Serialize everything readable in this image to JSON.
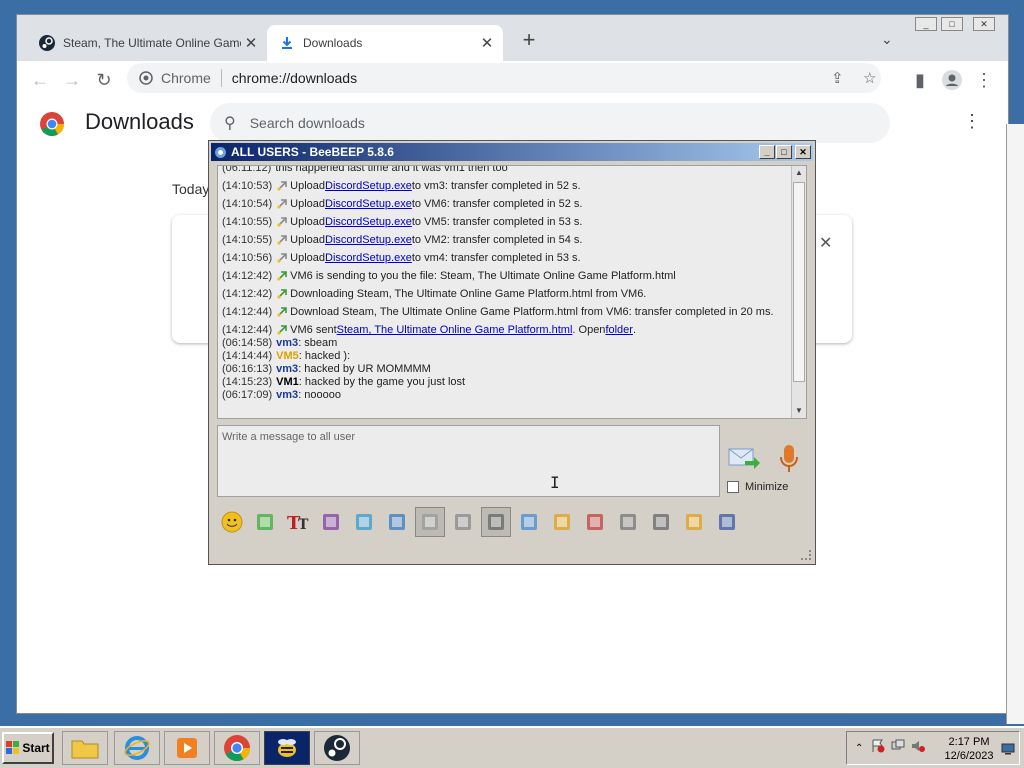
{
  "browser": {
    "tabs": [
      {
        "title": "Steam, The Ultimate Online Game P"
      },
      {
        "title": "Downloads"
      }
    ],
    "site_label": "Chrome",
    "url": "chrome://downloads"
  },
  "downloads_page": {
    "title": "Downloads",
    "search_placeholder": "Search downloads",
    "section_label": "Today"
  },
  "beebeep": {
    "title": "ALL USERS - BeeBEEP 5.8.6",
    "chat": [
      {
        "ts": "(06:11:12)",
        "pre": "this happened last time and it was vm1 then too",
        "icon": "",
        "who": "",
        "link": "",
        "post": "",
        "link2": "",
        "post2": ""
      },
      {
        "ts": "(14:10:53)",
        "icon": "upload-icon",
        "pre": "Upload ",
        "link": "DiscordSetup.exe",
        "post": " to vm3: transfer completed in 52 s.",
        "who": "",
        "link2": "",
        "post2": ""
      },
      {
        "ts": "(14:10:54)",
        "icon": "upload-icon",
        "pre": "Upload ",
        "link": "DiscordSetup.exe",
        "post": " to VM6: transfer completed in 52 s.",
        "who": "",
        "link2": "",
        "post2": ""
      },
      {
        "ts": "(14:10:55)",
        "icon": "upload-icon",
        "pre": "Upload ",
        "link": "DiscordSetup.exe",
        "post": " to VM5: transfer completed in 53 s.",
        "who": "",
        "link2": "",
        "post2": ""
      },
      {
        "ts": "(14:10:55)",
        "icon": "upload-icon",
        "pre": "Upload ",
        "link": "DiscordSetup.exe",
        "post": " to VM2: transfer completed in 54 s.",
        "who": "",
        "link2": "",
        "post2": ""
      },
      {
        "ts": "(14:10:56)",
        "icon": "upload-icon",
        "pre": "Upload ",
        "link": "DiscordSetup.exe",
        "post": " to vm4: transfer completed in 53 s.",
        "who": "",
        "link2": "",
        "post2": ""
      },
      {
        "ts": "(14:12:42)",
        "icon": "download-icon",
        "pre": "VM6 is sending to you the file: Steam, The Ultimate Online Game Platform.html",
        "link": "",
        "post": "",
        "who": "",
        "link2": "",
        "post2": ""
      },
      {
        "ts": "(14:12:42)",
        "icon": "download-icon",
        "pre": "Downloading Steam, The Ultimate Online Game Platform.html from VM6.",
        "link": "",
        "post": "",
        "who": "",
        "link2": "",
        "post2": ""
      },
      {
        "ts": "(14:12:44)",
        "icon": "download-icon",
        "pre": "Download Steam, The Ultimate Online Game Platform.html from VM6: transfer completed in 20 ms.",
        "link": "",
        "post": "",
        "who": "",
        "link2": "",
        "post2": ""
      },
      {
        "ts": "(14:12:44)",
        "icon": "download-icon",
        "pre": "VM6 sent ",
        "link": "Steam, The Ultimate Online Game Platform.html",
        "post": ". Open ",
        "link2": "folder",
        "post2": ".",
        "who": ""
      },
      {
        "ts": "(06:14:58)",
        "icon": "",
        "who": "vm3",
        "whoColor": "#1a3a9a",
        "pre": ": sbeam",
        "link": "",
        "post": "",
        "link2": "",
        "post2": ""
      },
      {
        "ts": "(14:14:44)",
        "icon": "",
        "who": "VM5",
        "whoColor": "#e0a000",
        "pre": ": hacked ):",
        "link": "",
        "post": "",
        "link2": "",
        "post2": ""
      },
      {
        "ts": "(06:16:13)",
        "icon": "",
        "who": "vm3",
        "whoColor": "#1a3a9a",
        "pre": ": hacked by UR MOMMMM",
        "link": "",
        "post": "",
        "link2": "",
        "post2": ""
      },
      {
        "ts": "(14:15:23)",
        "icon": "",
        "who": "VM1",
        "whoColor": "#000000",
        "pre": ": hacked by the game you just lost",
        "link": "",
        "post": "",
        "link2": "",
        "post2": ""
      },
      {
        "ts": "(06:17:09)",
        "icon": "",
        "who": "vm3",
        "whoColor": "#1a3a9a",
        "pre": ": nooooo",
        "link": "",
        "post": "",
        "link2": "",
        "post2": ""
      }
    ],
    "message_placeholder": "Write a message to all user",
    "minimize_label": "Minimize",
    "toolbar_icons": [
      "smiley-icon",
      "envelope-icon",
      "font-icon",
      "color-picker-icon",
      "filter-icon",
      "settings-gear-icon",
      "download-tray-icon",
      "font-size-icon",
      "music-note-icon",
      "send-file-icon",
      "send-folder-icon",
      "code-icon",
      "record-icon",
      "screenshot-icon",
      "edit-note-icon",
      "save-icon"
    ]
  },
  "taskbar": {
    "start_label": "Start",
    "clock_time": "2:17 PM",
    "clock_date": "12/6/2023"
  },
  "colors": {
    "desktop": "#3a6ea5",
    "titlebar": "#0a246a",
    "link": "#0000cc"
  }
}
